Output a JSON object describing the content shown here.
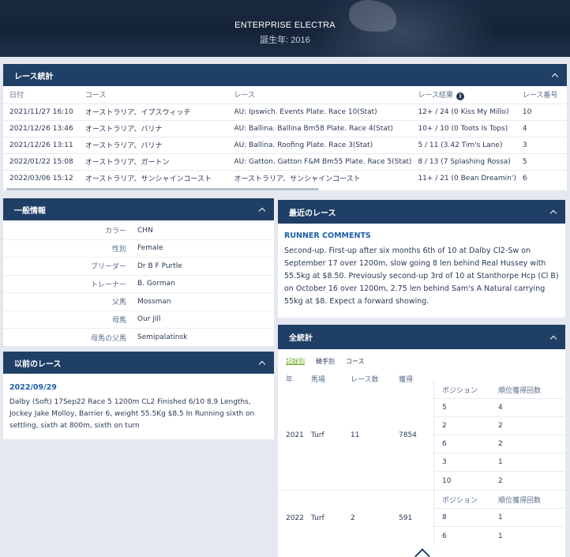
{
  "hero": {
    "title": "ENTERPRISE ELECTRA",
    "subtitle": "誕生年: 2016"
  },
  "race_stats": {
    "title": "レース統計",
    "columns": [
      "日付",
      "コース",
      "レース",
      "レース結果",
      "レース番号"
    ],
    "rows": [
      [
        "2021/11/27 16:10",
        "オーストラリア、イプスウィッチ",
        "AU: Ipswich. Events Plate. Race 10(Stat)",
        "12+ / 24 (0 Kiss My Millo)",
        "10"
      ],
      [
        "2021/12/26 13:46",
        "オーストラリア、バリナ",
        "AU: Ballina. Ballina Bm58 Plate. Race 4(Stat)",
        "10+ / 10 (0 Toots Is Tops)",
        "4"
      ],
      [
        "2021/12/26 13:11",
        "オーストラリア、バリナ",
        "AU: Ballina. Roofing Plate. Race 3(Stat)",
        "5 / 11 (3.42 Tim's Lane)",
        "3"
      ],
      [
        "2022/01/22 15:08",
        "オーストラリア、ガートン",
        "AU: Gatton. Gatton F&M Bm55 Plate. Race 5(Stat)",
        "8 / 13 (7 Splashing Rossa)",
        "5"
      ],
      [
        "2022/03/06 15:12",
        "オーストラリア、サンシャインコースト",
        "オーストラリア、サンシャインコースト",
        "11+ / 21 (0 Bean Dreamin')",
        "6"
      ]
    ]
  },
  "general_info": {
    "title": "一般情報",
    "rows": [
      {
        "label": "カラー",
        "value": "CHN"
      },
      {
        "label": "性別",
        "value": "Female"
      },
      {
        "label": "ブリーダー",
        "value": "Dr B F Purtle"
      },
      {
        "label": "トレーナー",
        "value": "B. Gorman"
      },
      {
        "label": "父馬",
        "value": "Mossman"
      },
      {
        "label": "母馬",
        "value": "Our Jill"
      },
      {
        "label": "母馬の父馬",
        "value": "Semipalatinsk"
      }
    ]
  },
  "previous_race": {
    "title": "以前のレース",
    "date": "2022/09/29",
    "text": "Dalby (Soft) 17Sep22 Race 5 1200m CL2 Finished 6/10 8.9 Lengths, Jockey Jake Molloy, Barrier 6, weight 55.5Kg $8.5 In Running sixth on settling, sixth at 800m, sixth on turn"
  },
  "recent_race": {
    "title": "最近のレース",
    "comments_title": "RUNNER COMMENTS",
    "text": "Second-up. First-up after six months 6th of 10 at Dalby Cl2-Sw on September 17 over 1200m, slow going 8 len behind Real Hussey with 55.5kg at $8.50. Previously second-up 3rd of 10 at Stanthorpe Hcp (Cl B) on October 16 over 1200m, 2.75 len behind Sam's A Natural carrying 55kg at $8. Expect a forward showing."
  },
  "full_stats": {
    "title": "全統計",
    "tabs": [
      "記録別",
      "騎手別",
      "コース"
    ],
    "columns": [
      "年",
      "馬場",
      "レース数",
      "獲得"
    ],
    "sub_columns": [
      "ポジション",
      "順位獲得回数"
    ],
    "years": [
      {
        "year": "2021",
        "surface": "Turf",
        "races": "11",
        "earned": "7854",
        "positions": [
          [
            "5",
            "4"
          ],
          [
            "2",
            "2"
          ],
          [
            "6",
            "2"
          ],
          [
            "3",
            "1"
          ],
          [
            "10",
            "2"
          ]
        ]
      },
      {
        "year": "2022",
        "surface": "Turf",
        "races": "2",
        "earned": "591",
        "positions": [
          [
            "8",
            "1"
          ],
          [
            "6",
            "1"
          ]
        ]
      }
    ]
  },
  "icons": {
    "collapse": "chevron-up-icon",
    "info": "info-icon",
    "scroll_top": "scroll-top-icon"
  },
  "colors": {
    "panel_header": "#1f3f66",
    "accent_blue": "#1f5fa8",
    "tab_active": "#6aa516",
    "background": "#e6e8ef"
  }
}
